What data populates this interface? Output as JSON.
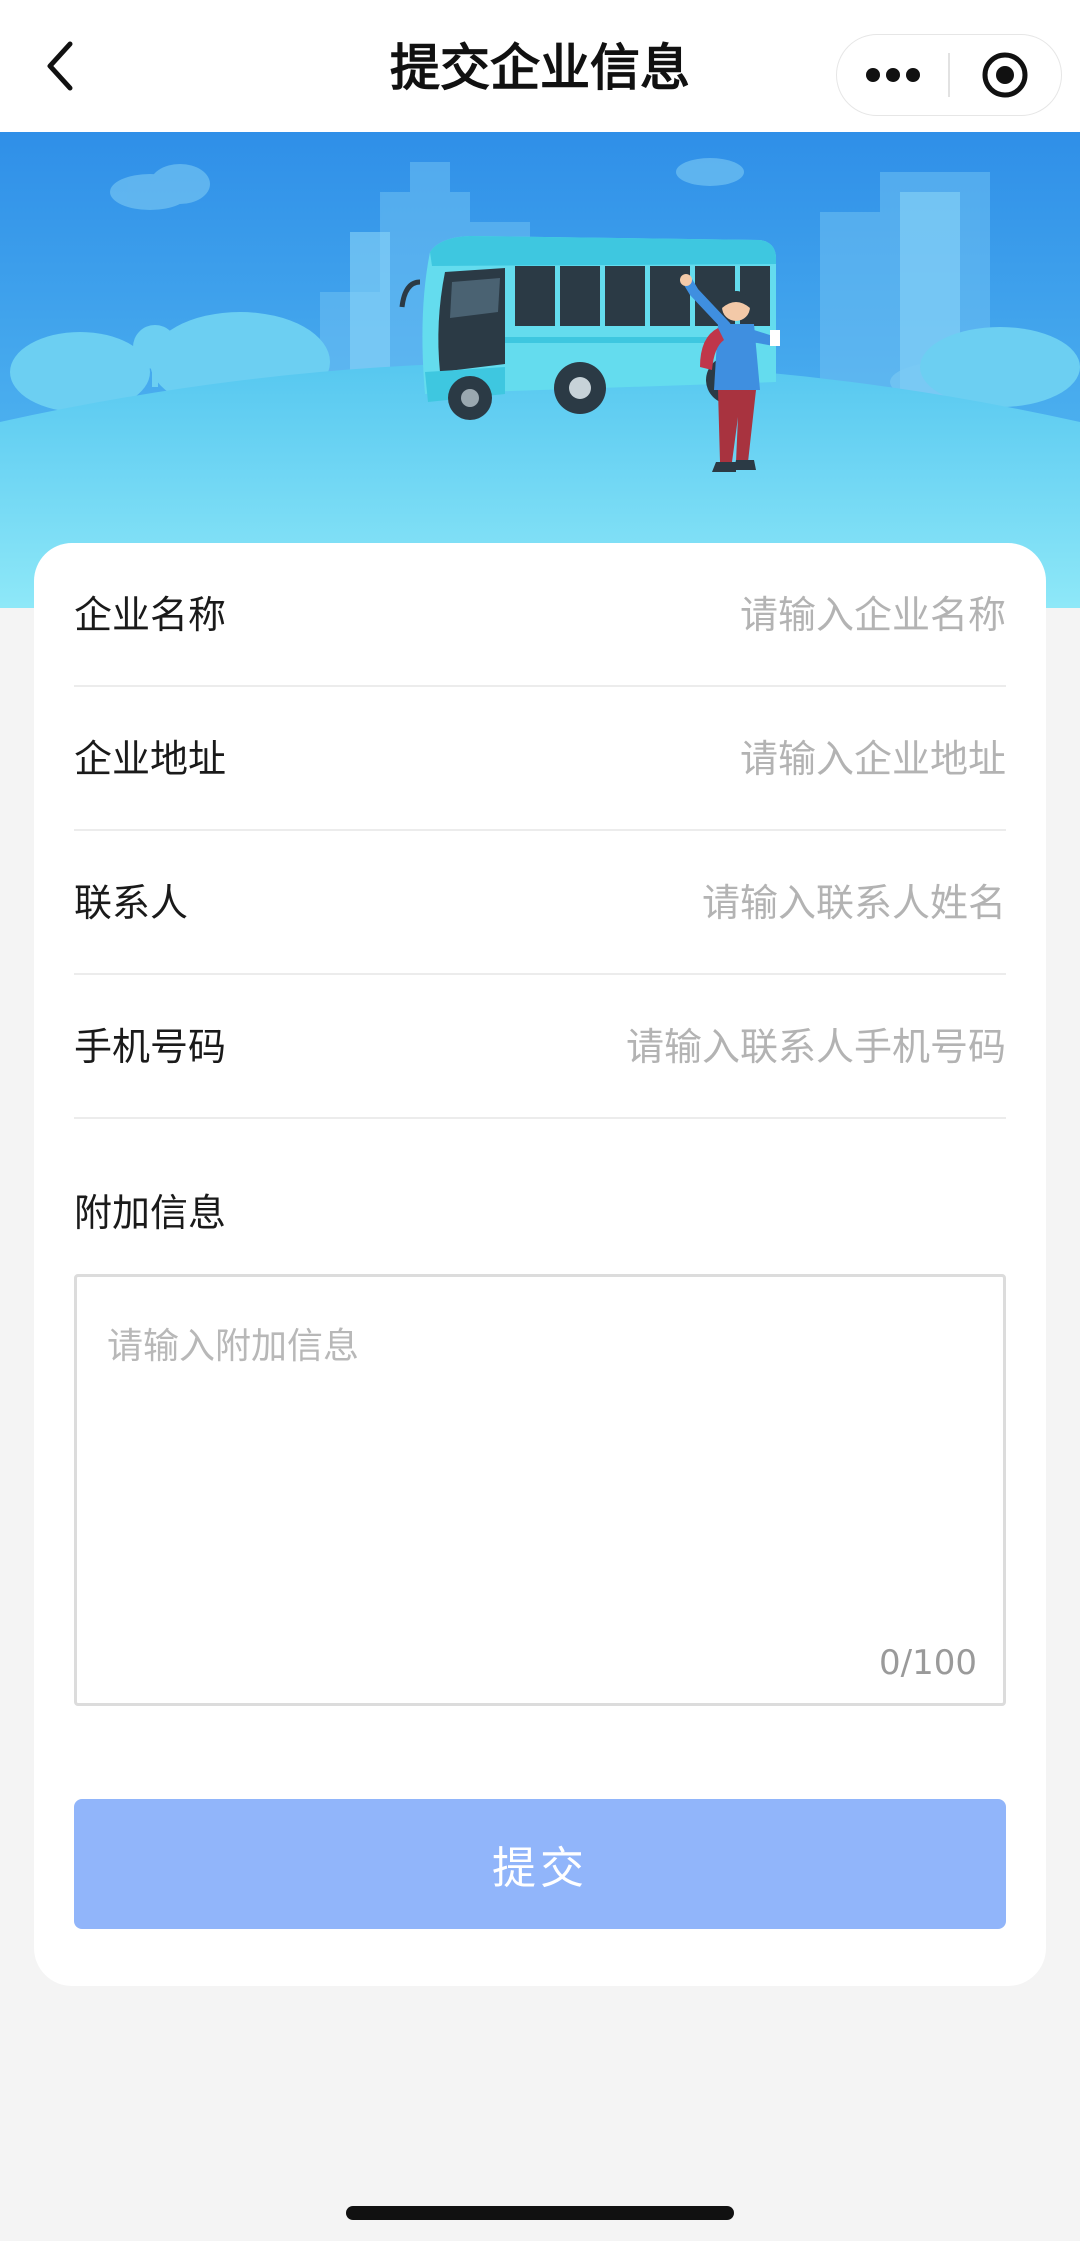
{
  "navbar": {
    "title": "提交企业信息",
    "back_icon": "chevron-left-icon",
    "more_icon": "more-dots-icon",
    "close_icon": "target-circle-icon"
  },
  "form": {
    "fields": [
      {
        "label": "企业名称",
        "placeholder": "请输入企业名称",
        "value": ""
      },
      {
        "label": "企业地址",
        "placeholder": "请输入企业地址",
        "value": ""
      },
      {
        "label": "联系人",
        "placeholder": "请输入联系人姓名",
        "value": ""
      },
      {
        "label": "手机号码",
        "placeholder": "请输入联系人手机号码",
        "value": ""
      }
    ],
    "extra": {
      "label": "附加信息",
      "placeholder": "请输入附加信息",
      "counter": "0/100"
    },
    "submit_label": "提交"
  },
  "colors": {
    "banner_sky": "#3aa0f0",
    "banner_ground": "#7fe0f6",
    "bus_body": "#6fe0f0",
    "submit_bg": "#91b5fa",
    "page_bg": "#f4f4f4"
  }
}
